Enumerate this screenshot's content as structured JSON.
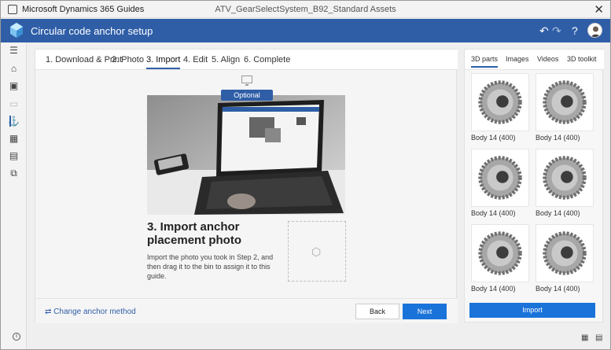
{
  "window": {
    "app_name": "Microsoft Dynamics 365 Guides",
    "document": "ATV_GearSelectSystem_B92_Standard Assets",
    "close_glyph": "✕"
  },
  "header": {
    "title": "Circular code anchor setup",
    "undo_glyph": "↶",
    "redo_glyph": "↷",
    "help_glyph": "?"
  },
  "rail": [
    {
      "name": "menu-icon",
      "glyph": "☰"
    },
    {
      "name": "home-icon",
      "glyph": "⌂"
    },
    {
      "name": "image-icon",
      "glyph": "▣"
    },
    {
      "name": "card-icon",
      "glyph": "▭"
    },
    {
      "name": "anchor-icon",
      "glyph": "⚓"
    },
    {
      "name": "grid-icon",
      "glyph": "▦"
    },
    {
      "name": "layout-icon",
      "glyph": "▤"
    },
    {
      "name": "layers-icon",
      "glyph": "⧉"
    }
  ],
  "steps": [
    "1. Download & Print",
    "2. Photo",
    "3. Import",
    "4. Edit",
    "5. Align",
    "6. Complete"
  ],
  "active_step": "3. Import",
  "content": {
    "badge": "Optional",
    "heading": "3. Import anchor placement photo",
    "description": "Import the photo you took in Step 2, and then drag it to the bin to assign it to this guide."
  },
  "footer": {
    "change_method": "Change anchor method",
    "change_glyph": "⇄",
    "back": "Back",
    "next": "Next"
  },
  "right_panel": {
    "tabs": [
      "3D parts",
      "Images",
      "Videos",
      "3D toolkit"
    ],
    "active_tab": "3D parts",
    "items": [
      "Body 14 (400)",
      "Body 14 (400)",
      "Body 14 (400)",
      "Body 14 (400)",
      "Body 14 (400)",
      "Body 14 (400)"
    ],
    "import": "Import"
  },
  "statusbar": {
    "info_glyph": "i",
    "grid_glyph": "▦",
    "panel_glyph": "▤"
  },
  "colors": {
    "brand_blue": "#2f5ea7",
    "button_blue": "#1a73d9"
  }
}
